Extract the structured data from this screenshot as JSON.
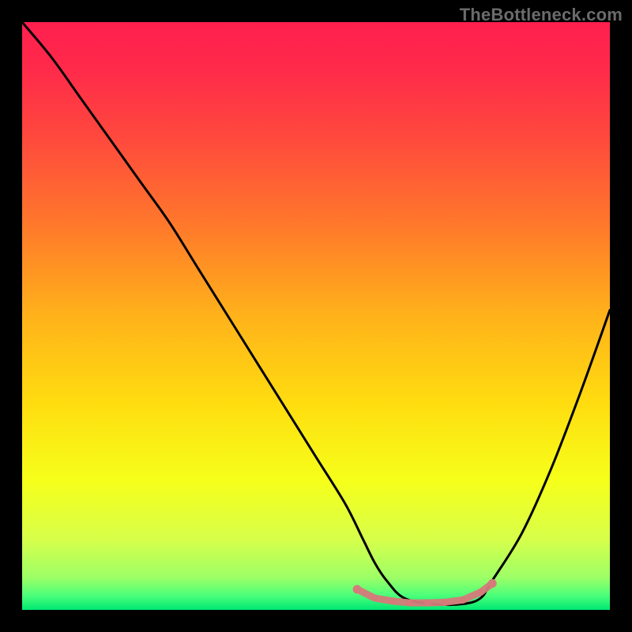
{
  "watermark": "TheBottleneck.com",
  "chart_data": {
    "type": "line",
    "title": "",
    "xlabel": "",
    "ylabel": "",
    "xlim": [
      0,
      100
    ],
    "ylim": [
      0,
      100
    ],
    "grid": false,
    "legend": false,
    "series": [
      {
        "name": "bottleneck-curve",
        "x": [
          0,
          5,
          10,
          15,
          20,
          25,
          30,
          35,
          40,
          45,
          50,
          55,
          58,
          60,
          62,
          65,
          70,
          75,
          78,
          80,
          85,
          90,
          95,
          100
        ],
        "y": [
          100,
          94,
          87,
          80,
          73,
          66,
          58,
          50,
          42,
          34,
          26,
          18,
          12,
          8,
          5,
          2,
          1,
          1,
          2,
          5,
          13,
          24,
          37,
          51
        ]
      }
    ],
    "zero_band": {
      "start_x": 57,
      "end_x": 80
    },
    "markers": {
      "name": "flat-zero-markers",
      "color": "#d57b7b",
      "points": [
        {
          "x": 57,
          "y": 3.5
        },
        {
          "x": 60,
          "y": 2.0
        },
        {
          "x": 63,
          "y": 1.5
        },
        {
          "x": 66,
          "y": 1.2
        },
        {
          "x": 69,
          "y": 1.2
        },
        {
          "x": 72,
          "y": 1.3
        },
        {
          "x": 75,
          "y": 1.7
        },
        {
          "x": 78,
          "y": 3.0
        },
        {
          "x": 80,
          "y": 4.5
        }
      ]
    },
    "background_gradient": {
      "stops": [
        {
          "offset": 0.0,
          "color": "#ff1f4f"
        },
        {
          "offset": 0.08,
          "color": "#ff2a4a"
        },
        {
          "offset": 0.2,
          "color": "#ff4a3d"
        },
        {
          "offset": 0.35,
          "color": "#ff7a2a"
        },
        {
          "offset": 0.5,
          "color": "#ffb21a"
        },
        {
          "offset": 0.65,
          "color": "#ffdd10"
        },
        {
          "offset": 0.78,
          "color": "#f6ff1a"
        },
        {
          "offset": 0.88,
          "color": "#d7ff4a"
        },
        {
          "offset": 0.945,
          "color": "#9dff66"
        },
        {
          "offset": 0.975,
          "color": "#4dff7a"
        },
        {
          "offset": 1.0,
          "color": "#00e873"
        }
      ]
    }
  }
}
